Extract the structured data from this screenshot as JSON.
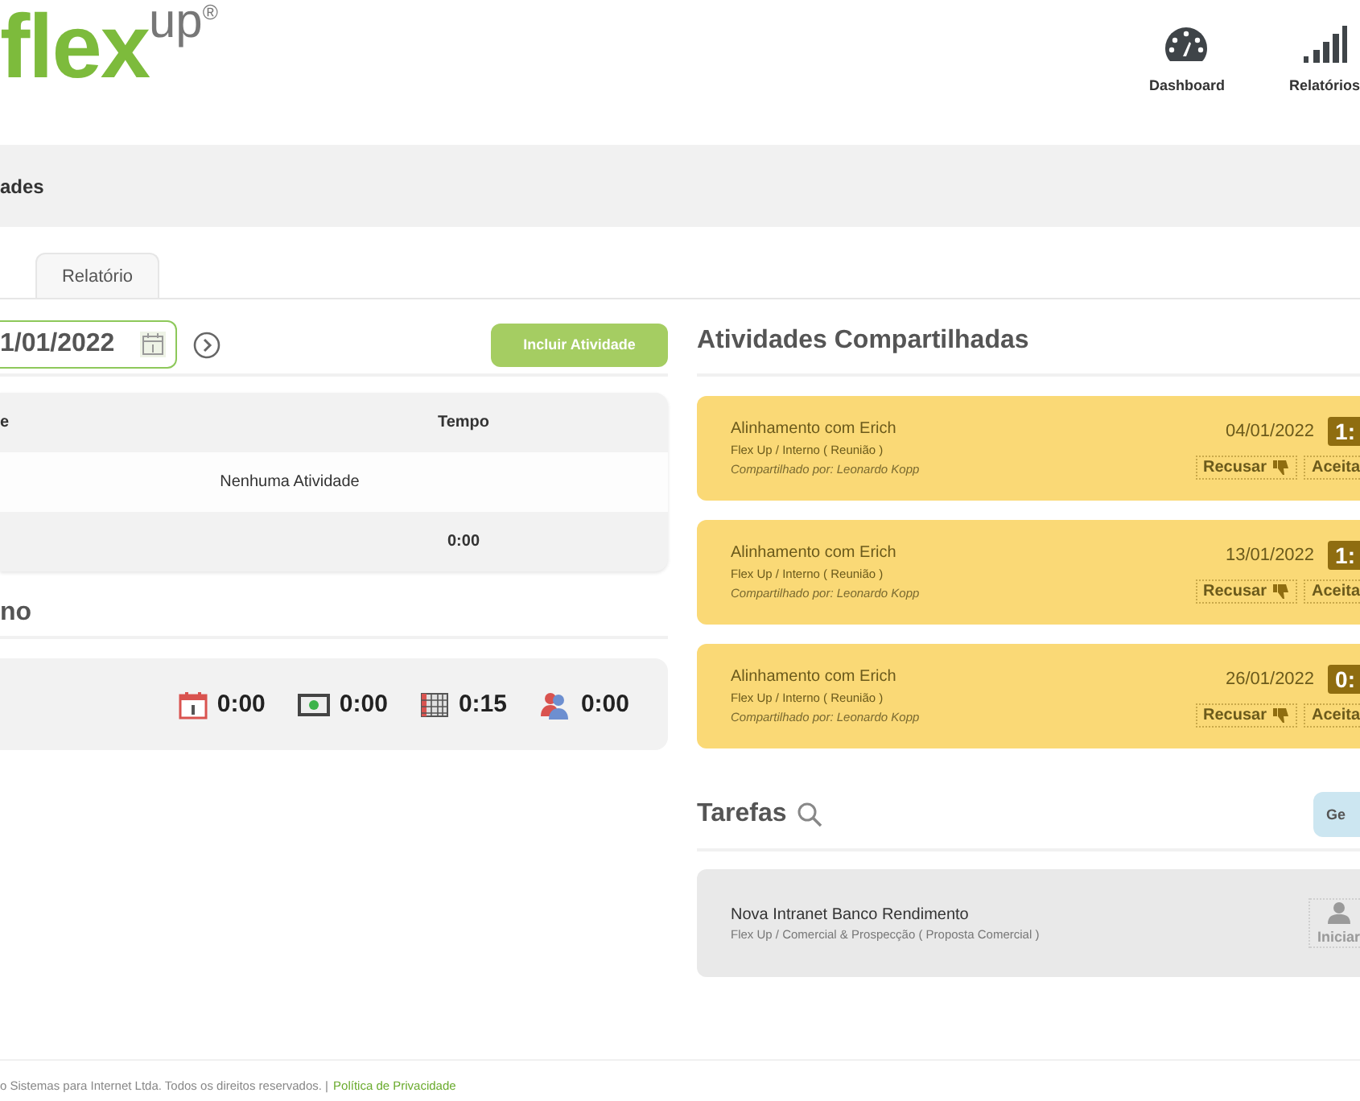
{
  "header": {
    "logo": {
      "main": "flex",
      "sup": "up",
      "mark": "®"
    },
    "nav": [
      {
        "label": "Dashboard",
        "kind": "gauge"
      },
      {
        "label": "Relatórios",
        "kind": "bars"
      }
    ]
  },
  "page_title": "ades",
  "tabs": [
    {
      "label": "Relatório",
      "selected": false
    }
  ],
  "left": {
    "date": "1/01/2022",
    "add_button": "Incluir Atividade",
    "table": {
      "columns": [
        "e",
        "Tempo"
      ],
      "empty": "Nenhuma Atividade",
      "total": "0:00"
    },
    "summary": {
      "title": "no",
      "items": [
        {
          "kind": "calendar",
          "value": "0:00"
        },
        {
          "kind": "screen",
          "value": "0:00"
        },
        {
          "kind": "grid",
          "value": "0:15"
        },
        {
          "kind": "people",
          "value": "0:00"
        }
      ]
    }
  },
  "shared": {
    "title": "Atividades Compartilhadas",
    "cards": [
      {
        "title": "Alinhamento com Erich",
        "project": "Flex Up / Interno ( Reunião )",
        "shared_by": "Compartilhado por: Leonardo Kopp",
        "date": "04/01/2022",
        "time": "1:",
        "decline": "Recusar",
        "accept": "Aceita"
      },
      {
        "title": "Alinhamento com Erich",
        "project": "Flex Up / Interno ( Reunião )",
        "shared_by": "Compartilhado por: Leonardo Kopp",
        "date": "13/01/2022",
        "time": "1:",
        "decline": "Recusar",
        "accept": "Aceita"
      },
      {
        "title": "Alinhamento com Erich",
        "project": "Flex Up / Interno ( Reunião )",
        "shared_by": "Compartilhado por: Leonardo Kopp",
        "date": "26/01/2022",
        "time": "0:",
        "decline": "Recusar",
        "accept": "Aceita"
      }
    ]
  },
  "tasks": {
    "title": "Tarefas",
    "button": "Ge",
    "items": [
      {
        "title": "Nova Intranet Banco Rendimento",
        "project": "Flex Up / Comercial & Prospecção ( Proposta Comercial )",
        "start": "Iniciar",
        "disabled": true
      }
    ]
  },
  "footer": {
    "text": "o Sistemas para Internet Ltda. Todos os direitos reservados. |",
    "link": "Política de Privacidade"
  }
}
